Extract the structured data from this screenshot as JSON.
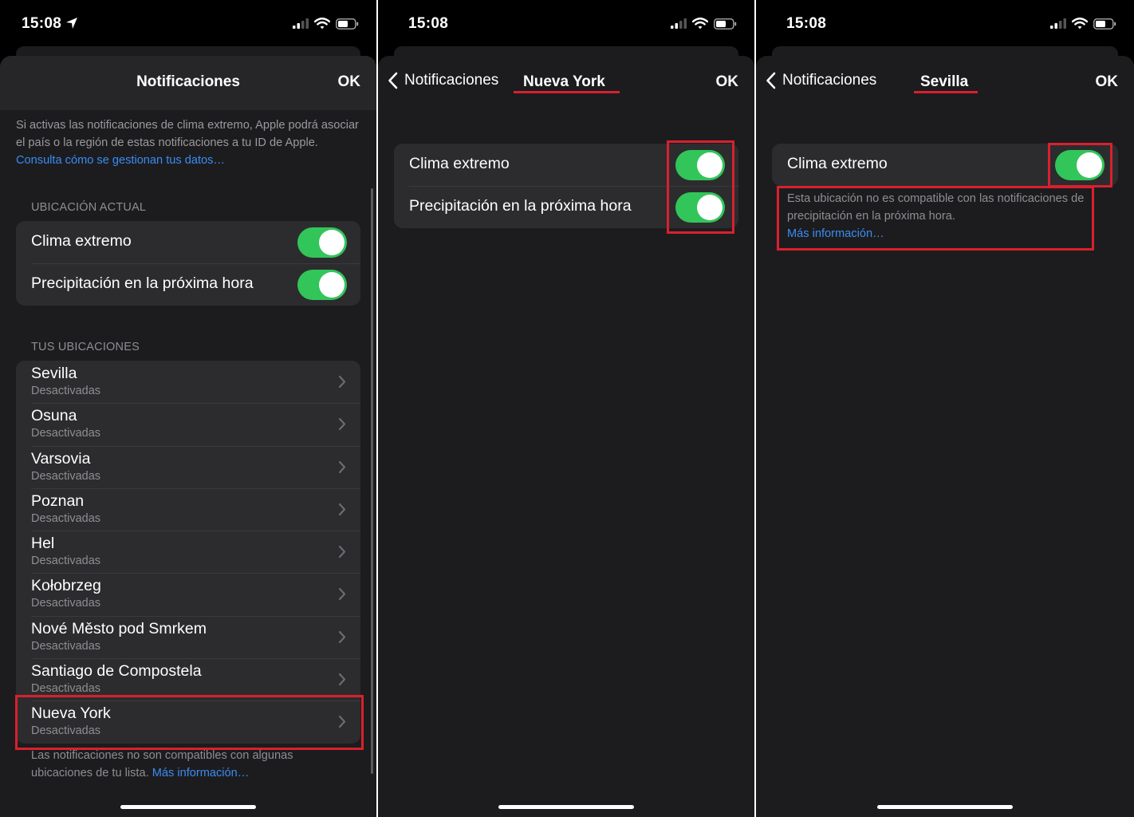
{
  "status": {
    "time": "15:08"
  },
  "colors": {
    "accent_link": "#3a8cf5",
    "toggle_on": "#32c55a",
    "highlight": "#d9202e",
    "background": "#1c1c1e"
  },
  "panel1": {
    "title": "Notificaciones",
    "ok": "OK",
    "intro_text": "Si activas las notificaciones de clima extremo, Apple podrá asociar el país o la región de estas notificaciones a tu ID de Apple.",
    "intro_link": "Consulta cómo se gestionan tus datos…",
    "current_header": "UBICACIÓN ACTUAL",
    "toggles": [
      {
        "label": "Clima extremo",
        "on": true
      },
      {
        "label": "Precipitación en la próxima hora",
        "on": true
      }
    ],
    "locations_header": "TUS UBICACIONES",
    "locations": [
      {
        "name": "Sevilla",
        "status": "Desactivadas"
      },
      {
        "name": "Osuna",
        "status": "Desactivadas"
      },
      {
        "name": "Varsovia",
        "status": "Desactivadas"
      },
      {
        "name": "Poznan",
        "status": "Desactivadas"
      },
      {
        "name": "Hel",
        "status": "Desactivadas"
      },
      {
        "name": "Kołobrzeg",
        "status": "Desactivadas"
      },
      {
        "name": "Nové Město pod Smrkem",
        "status": "Desactivadas"
      },
      {
        "name": "Santiago de Compostela",
        "status": "Desactivadas"
      },
      {
        "name": "Nueva York",
        "status": "Desactivadas"
      }
    ],
    "footnote_text": "Las notificaciones no son compatibles con algunas ubicaciones de tu lista.",
    "footnote_link": "Más información…"
  },
  "panel2": {
    "back": "Notificaciones",
    "title": "Nueva York",
    "ok": "OK",
    "toggles": [
      {
        "label": "Clima extremo",
        "on": true
      },
      {
        "label": "Precipitación en la próxima hora",
        "on": true
      }
    ]
  },
  "panel3": {
    "back": "Notificaciones",
    "title": "Sevilla",
    "ok": "OK",
    "toggles": [
      {
        "label": "Clima extremo",
        "on": true
      }
    ],
    "note_text": "Esta ubicación no es compatible con las notificaciones de precipitación en la próxima hora.",
    "note_link": "Más información…"
  }
}
